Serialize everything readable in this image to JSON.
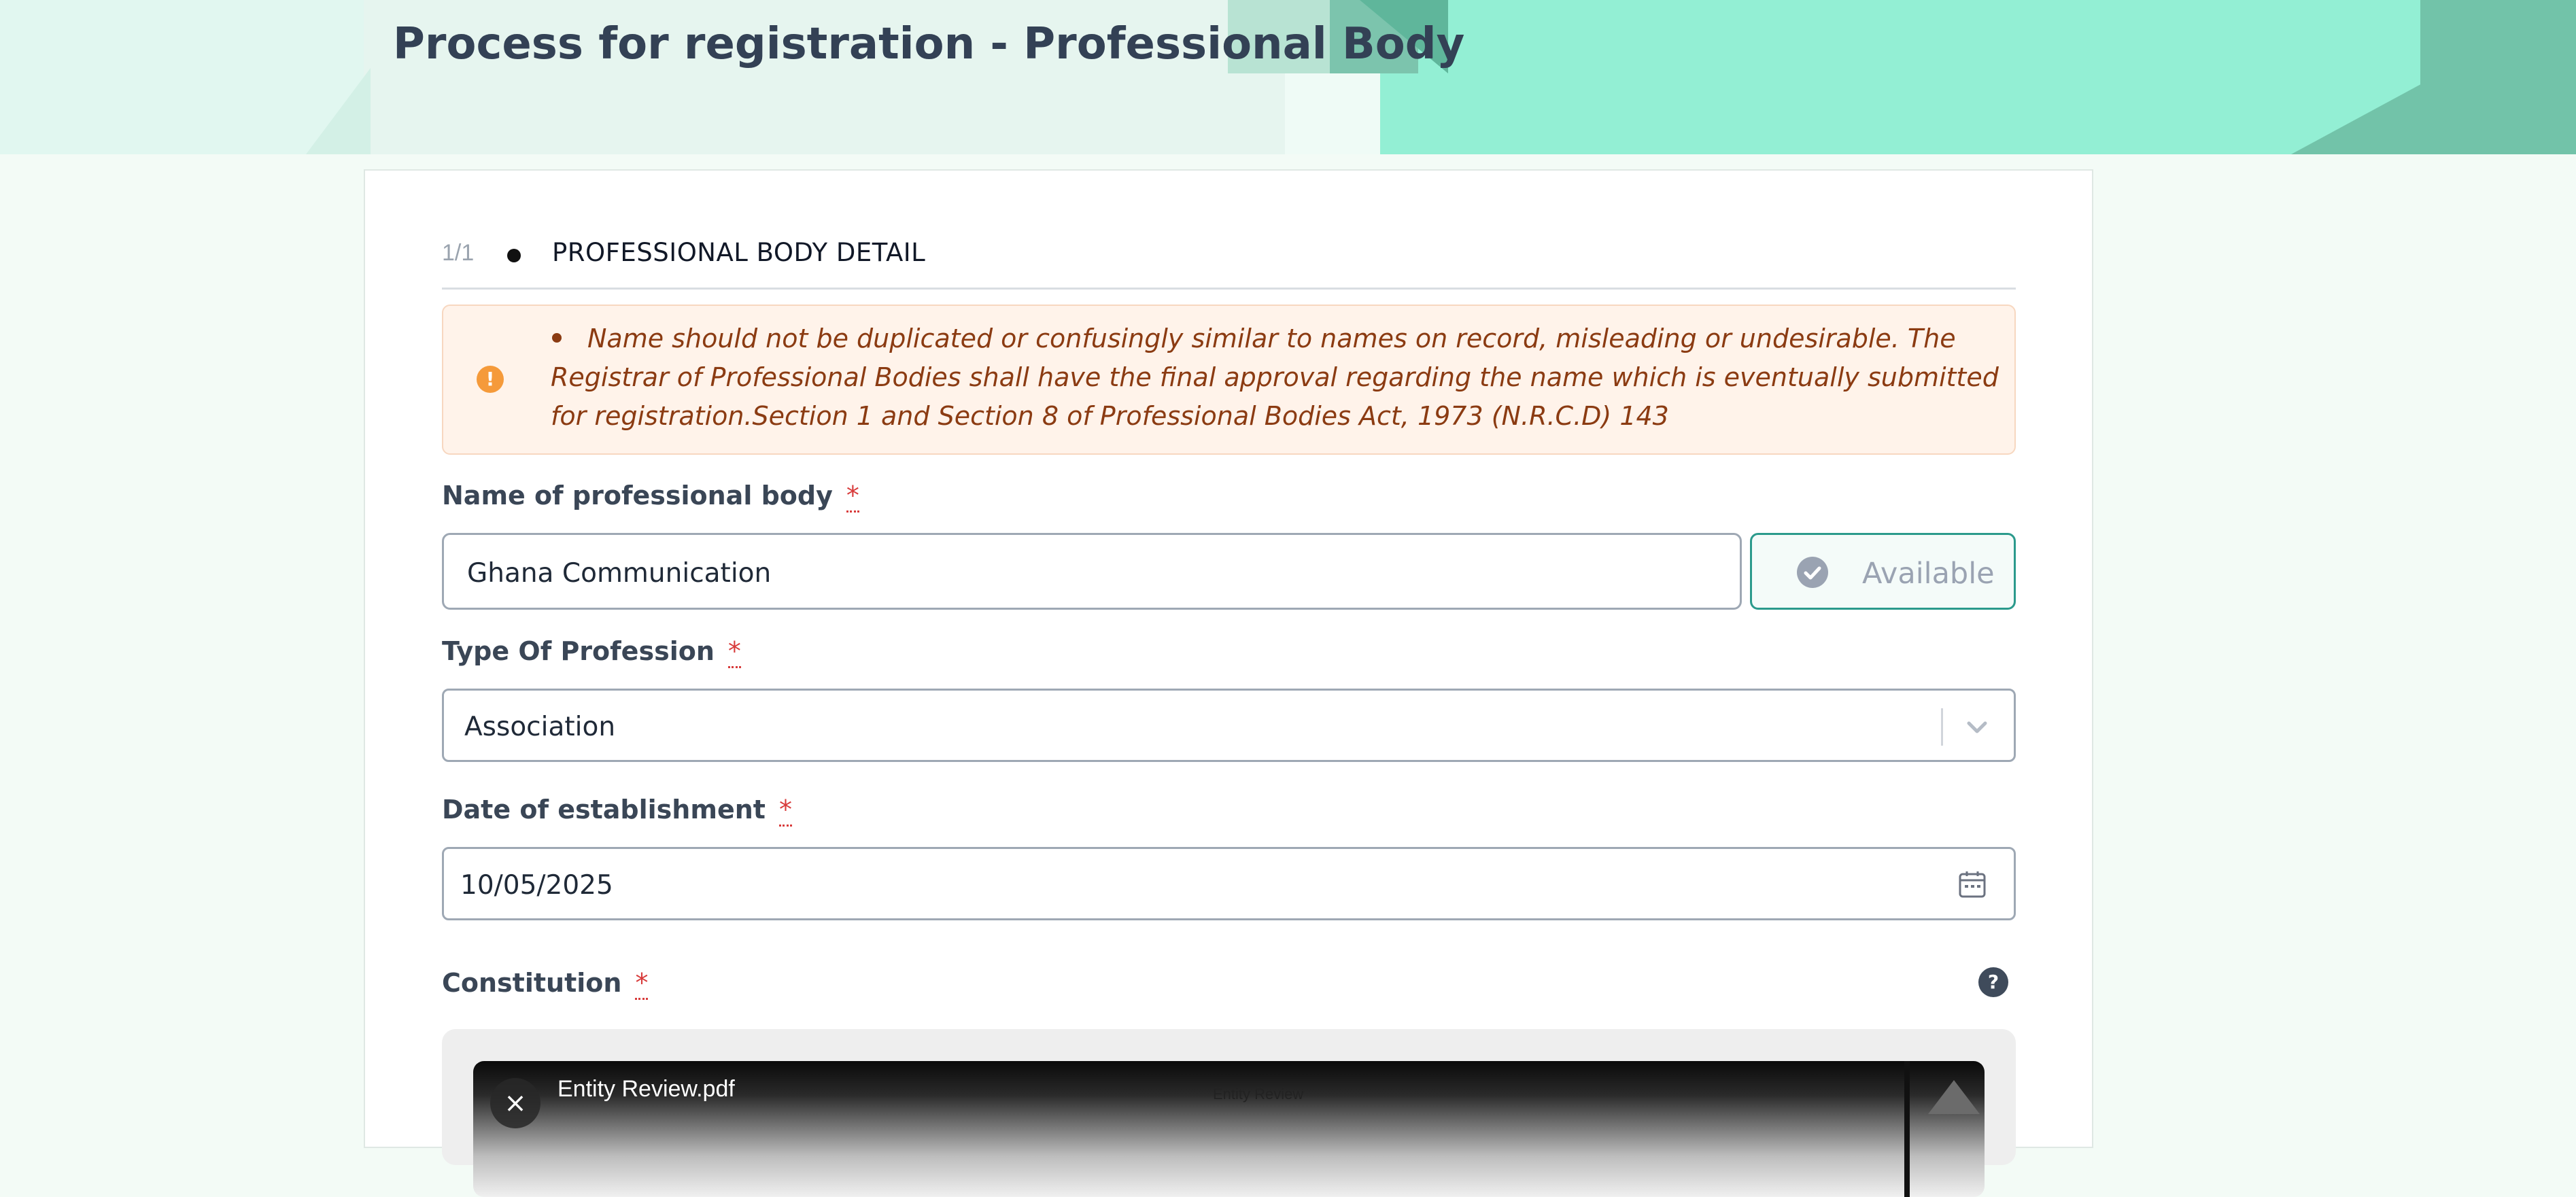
{
  "page": {
    "title": "Process for registration - Professional Body"
  },
  "stepper": {
    "count": "1/1",
    "label": "PROFESSIONAL BODY DETAIL"
  },
  "alert": {
    "icon": "exclamation-icon",
    "text": "Name should not be duplicated or confusingly similar to names on record, misleading or undesirable. The Registrar of Professional Bodies shall have the final approval regarding the name which is eventually submitted for registration.Section 1 and Section 8 of Professional Bodies Act, 1973 (N.R.C.D) 143"
  },
  "form": {
    "name": {
      "label": "Name of professional body",
      "required_mark": "*",
      "value": "Ghana Communication",
      "availability": "Available"
    },
    "profession_type": {
      "label": "Type Of Profession",
      "required_mark": "*",
      "selected": "Association"
    },
    "date_established": {
      "label": "Date of establishment",
      "required_mark": "*",
      "value": "10/05/2025"
    },
    "constitution": {
      "label": "Constitution",
      "required_mark": "*",
      "help_icon": "?",
      "file": {
        "name": "Entity Review.pdf",
        "preview_title": "Entity Review",
        "remove_icon": "×"
      }
    }
  },
  "colors": {
    "banner_accent": "#93efd4",
    "available_border": "#2b9a8c",
    "alert_text": "#8b3b12",
    "required": "#d83b3b"
  }
}
